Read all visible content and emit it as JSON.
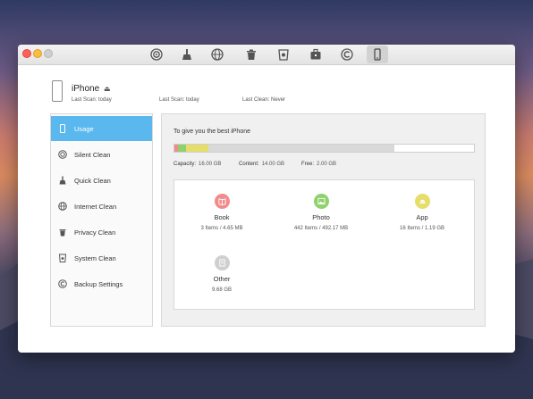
{
  "colors": {
    "accent": "#5ab8ee",
    "book": "#f28b8b",
    "photo": "#8fd16a",
    "app": "#e6dd6a",
    "other": "#cfcfcf",
    "bar_empty": "#d9d9d9"
  },
  "toolbar": {
    "buttons": [
      {
        "icon": "silent-clean-icon",
        "active": false
      },
      {
        "icon": "quick-clean-broom-icon",
        "active": false
      },
      {
        "icon": "internet-clean-globe-icon",
        "active": false
      },
      {
        "icon": "privacy-clean-trash-icon",
        "active": false
      },
      {
        "icon": "system-clean-bucket-icon",
        "active": false
      },
      {
        "icon": "toolbox-icon",
        "active": false
      },
      {
        "icon": "backup-settings-icon",
        "active": false
      },
      {
        "icon": "usage-phone-icon",
        "active": true
      }
    ]
  },
  "device": {
    "name": "iPhone",
    "last_scan_label": "Last Scan: today",
    "last_scan_label_2": "Last Scan: today",
    "last_clean_label": "Last Clean: Never"
  },
  "sidebar": {
    "items": [
      {
        "label": "Usage",
        "icon": "phone-icon",
        "active": true
      },
      {
        "label": "Silent Clean",
        "icon": "silent-clean-icon",
        "active": false
      },
      {
        "label": "Quick Clean",
        "icon": "broom-icon",
        "active": false
      },
      {
        "label": "Internet Clean",
        "icon": "globe-icon",
        "active": false
      },
      {
        "label": "Privacy Clean",
        "icon": "trash-icon",
        "active": false
      },
      {
        "label": "System Clean",
        "icon": "bucket-icon",
        "active": false
      },
      {
        "label": "Backup Settings",
        "icon": "backup-icon",
        "active": false
      }
    ]
  },
  "usage": {
    "hint": "To give you the best iPhone",
    "bar_segments": [
      {
        "name": "Book",
        "fraction": 0.013,
        "color": "#f28b8b"
      },
      {
        "name": "Photo",
        "fraction": 0.028,
        "color": "#8fd16a"
      },
      {
        "name": "App",
        "fraction": 0.075,
        "color": "#e6dd6a"
      },
      {
        "name": "Other",
        "fraction": 0.622,
        "color": "#d9d9d9"
      }
    ],
    "capacity_label": "Capacity:",
    "capacity_value": "16.00 GB",
    "content_label": "Content:",
    "content_value": "14.00 GB",
    "free_label": "Free:",
    "free_value": "2.00 GB",
    "categories": [
      {
        "name": "Book",
        "detail": "3 Items / 4.65 MB",
        "icon": "book-icon",
        "color": "#f28b8b"
      },
      {
        "name": "Photo",
        "detail": "442 Items / 492.17 MB",
        "icon": "photo-icon",
        "color": "#8fd16a"
      },
      {
        "name": "App",
        "detail": "16 Items / 1.19 GB",
        "icon": "app-icon",
        "color": "#e6dd6a"
      },
      {
        "name": "Other",
        "detail": "9.68 GB",
        "icon": "other-icon",
        "color": "#cfcfcf"
      }
    ]
  }
}
